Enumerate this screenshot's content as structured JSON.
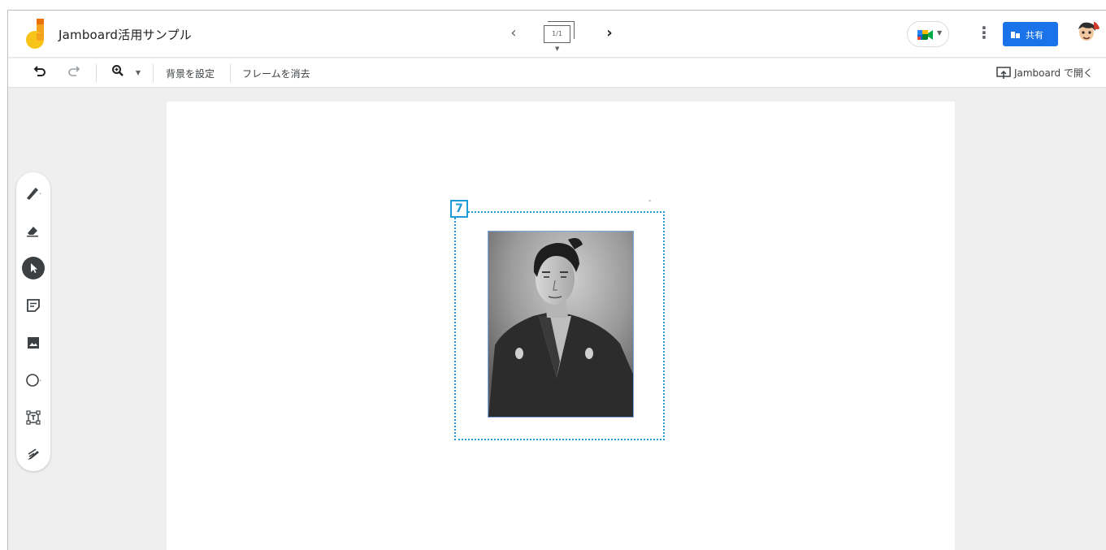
{
  "header": {
    "title": "Jamboard活用サンプル",
    "frame_counter": "1/1",
    "share_label": "共有"
  },
  "toolbar": {
    "set_background": "背景を設定",
    "clear_frame": "フレームを消去",
    "open_in_jamboard": "Jamboard で開く"
  },
  "tools": [
    "pen-icon",
    "eraser-icon",
    "select-icon",
    "sticky-note-icon",
    "image-icon",
    "circle-icon",
    "text-box-icon",
    "laser-icon"
  ],
  "active_tool": "select",
  "canvas": {
    "annotation_badge": "7"
  },
  "colors": {
    "share_button": "#1a73e8",
    "annotation": "#1f9bd7",
    "active_tool_bg": "#3c4043"
  }
}
